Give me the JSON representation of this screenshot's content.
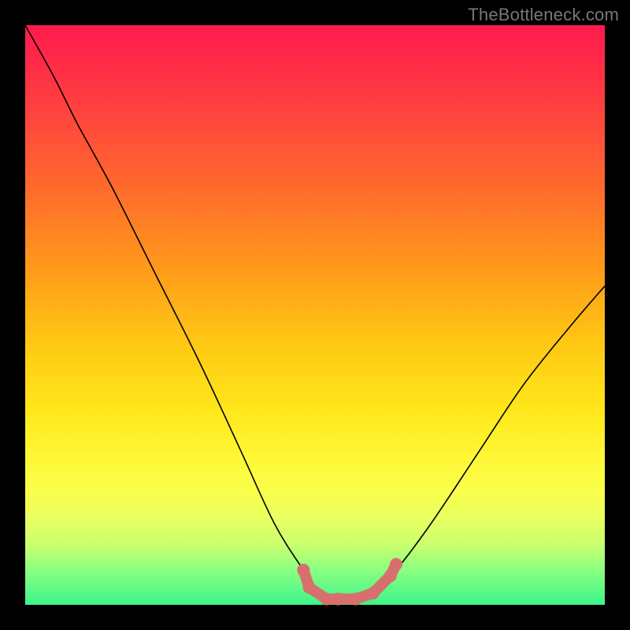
{
  "watermark": {
    "text": "TheBottleneck.com"
  },
  "chart_data": {
    "type": "line",
    "title": "",
    "xlabel": "",
    "ylabel": "",
    "xlim": [
      0,
      100
    ],
    "ylim": [
      0,
      100
    ],
    "series": [
      {
        "name": "bottleneck-curve",
        "x": [
          0,
          5,
          9,
          15,
          22,
          30,
          37,
          43,
          48,
          51,
          54,
          57,
          60,
          64,
          70,
          78,
          86,
          94,
          100
        ],
        "y": [
          100,
          91,
          83,
          72,
          58,
          42,
          27,
          14,
          6,
          2,
          1,
          1,
          2,
          6,
          14,
          26,
          38,
          48,
          55
        ]
      }
    ],
    "markers": {
      "name": "bottom-cluster",
      "color": "#d86f6f",
      "points": [
        {
          "x": 48,
          "y": 6
        },
        {
          "x": 49,
          "y": 3
        },
        {
          "x": 52,
          "y": 1
        },
        {
          "x": 54,
          "y": 1
        },
        {
          "x": 57,
          "y": 1
        },
        {
          "x": 60,
          "y": 2
        },
        {
          "x": 63,
          "y": 5
        },
        {
          "x": 64,
          "y": 7
        }
      ]
    },
    "background_gradient": {
      "top": "#ff1a4d",
      "mid": "#ffe61a",
      "bottom": "#3cf58a"
    }
  }
}
